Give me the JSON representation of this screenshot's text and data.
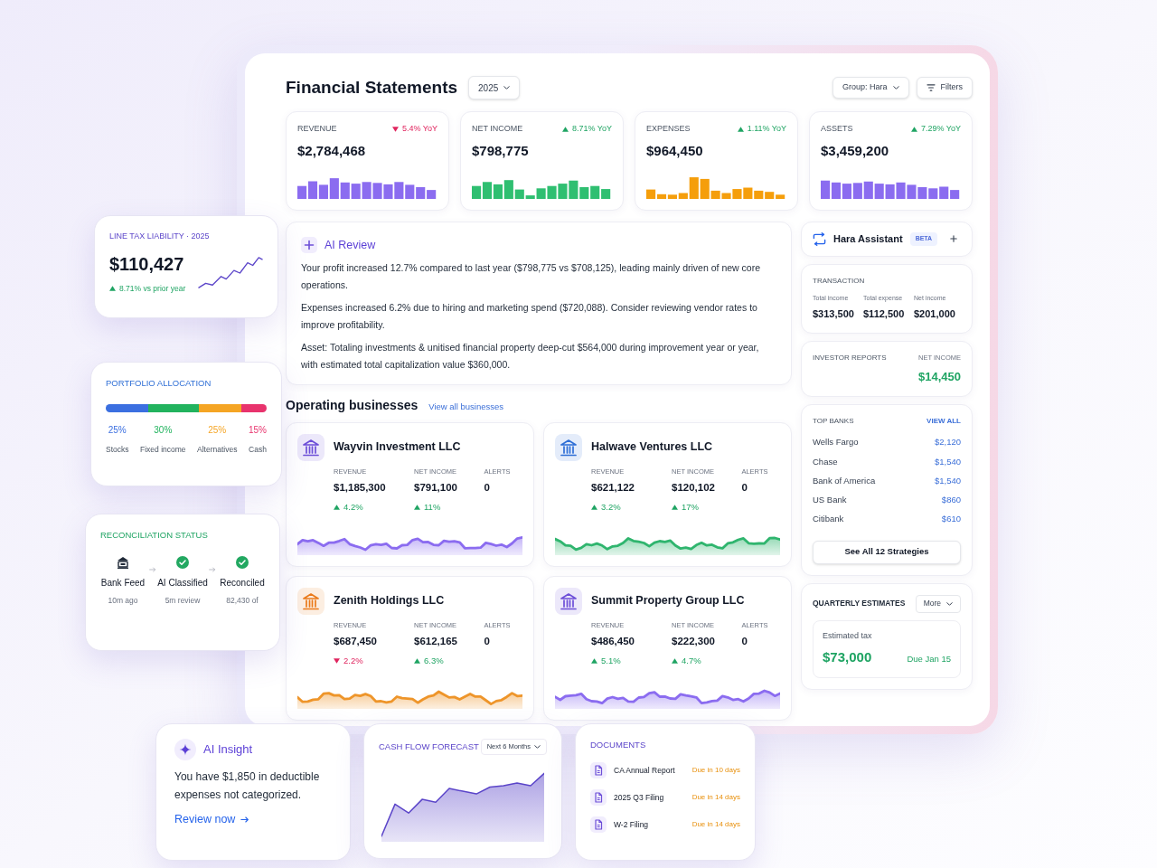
{
  "header": {
    "title": "Financial Statements",
    "year": "2025",
    "group": "Group: Hara",
    "filters": "Filters"
  },
  "stat_cards": [
    {
      "label": "REVENUE",
      "value": "$2,784,468",
      "change": "5.4% YoY",
      "rising": false,
      "color": "#8b6cf0"
    },
    {
      "label": "NET INCOME",
      "value": "$798,775",
      "change": "8.71% YoY",
      "rising": true,
      "color": "#2fbf71"
    },
    {
      "label": "EXPENSES",
      "value": "$964,450",
      "change": "1.11% YoY",
      "rising": true,
      "color": "#f59e0b"
    },
    {
      "label": "ASSETS",
      "value": "$3,459,200",
      "change": "7.29% YoY",
      "rising": true,
      "color": "#8b6cf0"
    }
  ],
  "tax_liability": {
    "title": "LINE TAX LIABILITY · 2025",
    "value": "$110,427",
    "change": "8.71% vs prior year",
    "rising": true
  },
  "portfolio": {
    "title": "PORTFOLIO ALLOCATION",
    "segments": [
      {
        "percent": "25%",
        "label": "Stocks",
        "color": "#3b6fe0"
      },
      {
        "percent": "30%",
        "label": "Fixed income",
        "color": "#22b35e"
      },
      {
        "percent": "25%",
        "label": "Alternatives",
        "color": "#f5a524"
      },
      {
        "percent": "15%",
        "label": "Cash",
        "color": "#e8336d"
      }
    ]
  },
  "reconciliation": {
    "title": "RECONCILIATION STATUS",
    "steps": [
      {
        "kind": "source",
        "label": "Bank Feed",
        "detail": "10m ago"
      },
      {
        "kind": "done",
        "label": "AI Classified",
        "detail": "5m review"
      },
      {
        "kind": "done",
        "label": "Reconciled",
        "detail": "82,430 of"
      }
    ]
  },
  "ai_review": {
    "title": "AI Review",
    "paragraphs": [
      "Your profit increased 12.7% compared to last year ($798,775 vs $708,125), leading mainly driven of new core operations.",
      "Expenses increased 6.2% due to hiring and marketing spend ($720,088). Consider reviewing vendor rates to improve profitability.",
      "Asset: Totaling investments & unitised financial property deep-cut $564,000 during improvement year or year, with estimated total capitalization value $360,000."
    ]
  },
  "assistant": {
    "title": "Hara Assistant",
    "badge": "BETA"
  },
  "transaction": {
    "title": "TRANSACTION",
    "items": [
      {
        "label": "Total income",
        "value": "$313,500"
      },
      {
        "label": "Total expense",
        "value": "$112,500"
      },
      {
        "label": "Net income",
        "value": "$201,000"
      }
    ]
  },
  "investor_reports": {
    "title": "INVESTOR REPORTS",
    "metric_label": "NET INCOME",
    "metric_value": "$14,450"
  },
  "operating_businesses": {
    "title": "Operating businesses",
    "link": "View all businesses",
    "businesses": [
      {
        "name": "Wayvin Investment LLC",
        "icon": {
          "color": "#6d4fd8"
        },
        "sparkline": {
          "color": "#8b6cf0"
        },
        "metrics": [
          {
            "label": "REVENUE",
            "value": "$1,185,300",
            "change": "4.2%",
            "rising": true
          },
          {
            "label": "NET INCOME",
            "value": "$791,100",
            "change": "11%",
            "rising": true
          },
          {
            "label": "ALERTS",
            "value": "0"
          }
        ]
      },
      {
        "name": "Halwave Ventures LLC",
        "icon": {
          "color": "#2f6fd6"
        },
        "sparkline": {
          "color": "#2fb56e"
        },
        "metrics": [
          {
            "label": "REVENUE",
            "value": "$621,122",
            "change": "3.2%",
            "rising": true
          },
          {
            "label": "NET INCOME",
            "value": "$120,102",
            "change": "17%",
            "rising": true
          },
          {
            "label": "ALERTS",
            "value": "0"
          }
        ]
      },
      {
        "name": "Zenith Holdings LLC",
        "icon": {
          "color": "#ea7a1a"
        },
        "sparkline": {
          "color": "#ee952a"
        },
        "metrics": [
          {
            "label": "REVENUE",
            "value": "$687,450",
            "change": "2.2%",
            "rising": false
          },
          {
            "label": "NET INCOME",
            "value": "$612,165",
            "change": "6.3%",
            "rising": true
          },
          {
            "label": "ALERTS",
            "value": "0"
          }
        ]
      },
      {
        "name": "Summit Property Group LLC",
        "icon": {
          "color": "#6d4fd8"
        },
        "sparkline": {
          "color": "#8b6cf0"
        },
        "metrics": [
          {
            "label": "REVENUE",
            "value": "$486,450",
            "change": "5.1%",
            "rising": true
          },
          {
            "label": "NET INCOME",
            "value": "$222,300",
            "change": "4.7%",
            "rising": true
          },
          {
            "label": "ALERTS",
            "value": "0"
          }
        ]
      }
    ]
  },
  "top_banks": {
    "title": "TOP BANKS",
    "link": "VIEW ALL",
    "rows": [
      {
        "name": "Wells Fargo",
        "amount": "$2,120"
      },
      {
        "name": "Chase",
        "amount": "$1,540"
      },
      {
        "name": "Bank of America",
        "amount": "$1,540"
      },
      {
        "name": "US Bank",
        "amount": "$860"
      },
      {
        "name": "Citibank",
        "amount": "$610"
      }
    ],
    "button": "See All 12 Strategies"
  },
  "quarterly_estimates": {
    "title": "QUARTERLY ESTIMATES",
    "select": "More",
    "label": "Estimated tax",
    "value": "$73,000",
    "due": "Due Jan 15"
  },
  "ai_insight": {
    "title": "AI Insight",
    "text": "You have $1,850 in deductible expenses not categorized.",
    "link": "Review now"
  },
  "cash_flow": {
    "title": "CASH FLOW FORECAST",
    "period": "Next 6 Months"
  },
  "documents": {
    "title": "DOCUMENTS",
    "items": [
      {
        "name": "CA Annual Report",
        "due": "Due in 10 days"
      },
      {
        "name": "2025 Q3 Filing",
        "due": "Due in 14 days"
      },
      {
        "name": "W-2 Filing",
        "due": "Due in 14 days"
      }
    ]
  }
}
